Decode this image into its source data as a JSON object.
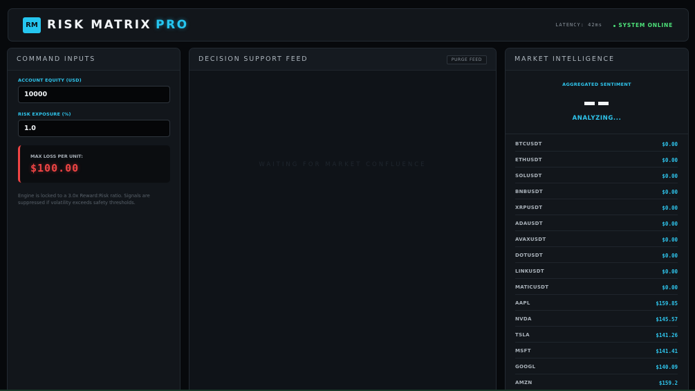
{
  "header": {
    "logo_text": "RM",
    "brand_name": "RISK MATRIX",
    "brand_suffix": "PRO",
    "latency": "LATENCY: 42ms",
    "status": "SYSTEM ONLINE"
  },
  "command_inputs": {
    "title": "COMMAND INPUTS",
    "equity_label": "ACCOUNT EQUITY (USD)",
    "equity_value": "10000",
    "risk_label": "RISK EXPOSURE (%)",
    "risk_value": "1.0",
    "max_loss_label": "MAX LOSS PER UNIT:",
    "max_loss_value": "$100.00",
    "note": "Engine is locked to a 3.0x Reward:Risk ratio. Signals are suppressed if volatility exceeds safety thresholds."
  },
  "feed": {
    "title": "DECISION SUPPORT FEED",
    "purge_label": "PURGE FEED",
    "waiting_text": "WAITING FOR MARKET CONFLUENCE"
  },
  "market": {
    "title": "MARKET INTELLIGENCE",
    "sentiment_label": "AGGREGATED SENTIMENT",
    "sentiment_status": "ANALYZING...",
    "tickers": [
      {
        "symbol": "BTCUSDT",
        "price": "$0.00"
      },
      {
        "symbol": "ETHUSDT",
        "price": "$0.00"
      },
      {
        "symbol": "SOLUSDT",
        "price": "$0.00"
      },
      {
        "symbol": "BNBUSDT",
        "price": "$0.00"
      },
      {
        "symbol": "XRPUSDT",
        "price": "$0.00"
      },
      {
        "symbol": "ADAUSDT",
        "price": "$0.00"
      },
      {
        "symbol": "AVAXUSDT",
        "price": "$0.00"
      },
      {
        "symbol": "DOTUSDT",
        "price": "$0.00"
      },
      {
        "symbol": "LINKUSDT",
        "price": "$0.00"
      },
      {
        "symbol": "MATICUSDT",
        "price": "$0.00"
      },
      {
        "symbol": "AAPL",
        "price": "$159.85"
      },
      {
        "symbol": "NVDA",
        "price": "$145.57"
      },
      {
        "symbol": "TSLA",
        "price": "$141.26"
      },
      {
        "symbol": "MSFT",
        "price": "$141.41"
      },
      {
        "symbol": "GOOGL",
        "price": "$140.09"
      },
      {
        "symbol": "AMZN",
        "price": "$159.2"
      }
    ]
  },
  "colors": {
    "accent": "#25c6f0",
    "online": "#4ee37a",
    "danger": "#ef4444",
    "background": "#07090c"
  }
}
